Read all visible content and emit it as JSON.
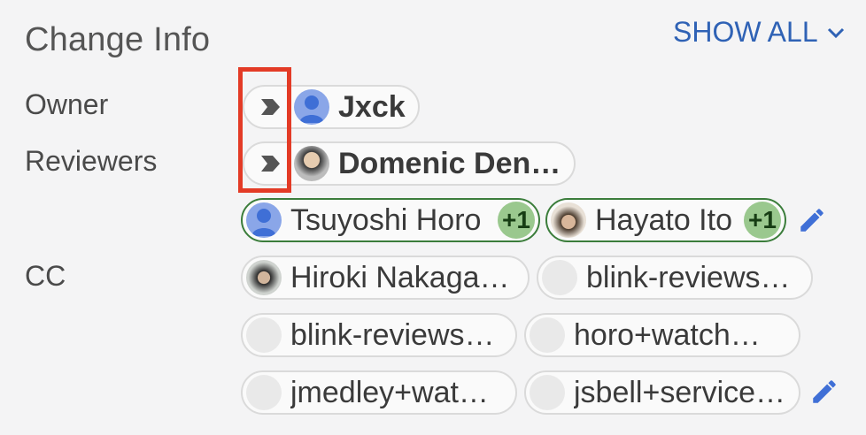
{
  "header": {
    "title": "Change Info",
    "show_all_label": "SHOW ALL"
  },
  "owner": {
    "label": "Owner",
    "name": "Jxck"
  },
  "reviewers": {
    "label": "Reviewers",
    "primary": "Domenic Deni…",
    "list": [
      {
        "name": "Tsuyoshi Horo",
        "vote": "+1"
      },
      {
        "name": "Hayato Ito",
        "vote": "+1"
      }
    ]
  },
  "cc": {
    "label": "CC",
    "list": [
      "Hiroki Nakaga…",
      "blink-reviews-…",
      "blink-reviews…",
      "horo+watch@…",
      "jmedley+watc…",
      "jsbell+service…"
    ]
  },
  "colors": {
    "accent": "#2f62b5",
    "vote_bg": "#9ac88e",
    "vote_border": "#3b7d3b",
    "highlight": "#e33b26"
  },
  "icons": {
    "show_all": "chevron-down-icon",
    "attention": "attention-arrow-icon",
    "edit": "pencil-icon",
    "avatar_default": "person-icon"
  }
}
